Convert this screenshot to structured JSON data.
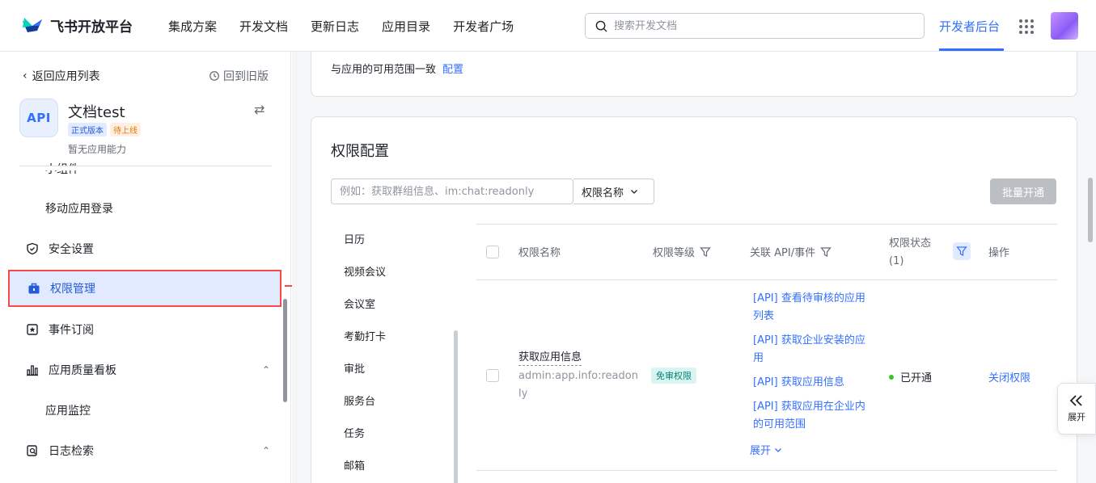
{
  "header": {
    "logo_text": "飞书开放平台",
    "nav": [
      "集成方案",
      "开发文档",
      "更新日志",
      "应用目录",
      "开发者广场"
    ],
    "search_placeholder": "搜索开发文档",
    "dev_console": "开发者后台"
  },
  "sidebar": {
    "back_label": "返回应用列表",
    "old_version_label": "回到旧版",
    "app_icon_text": "API",
    "app_name": "文档test",
    "badge_release": "正式版本",
    "badge_pending": "待上线",
    "app_sub": "暂无应用能力",
    "items": {
      "widget": "小组件",
      "mobile_login": "移动应用登录",
      "security": "安全设置",
      "permissions": "权限管理",
      "events": "事件订阅",
      "quality": "应用质量看板",
      "monitor": "应用监控",
      "logs": "日志检索"
    }
  },
  "main": {
    "scope_text": "与应用的可用范围一致",
    "scope_link": "配置",
    "perm_title": "权限配置",
    "perm_search_placeholder": "例如：获取群组信息、im:chat:readonly",
    "perm_select_label": "权限名称",
    "batch_button": "批量开通",
    "categories": [
      "日历",
      "视频会议",
      "会议室",
      "考勤打卡",
      "审批",
      "服务台",
      "任务",
      "邮箱"
    ],
    "table": {
      "col_name": "权限名称",
      "col_level": "权限等级",
      "col_api": "关联 API/事件",
      "col_status": "权限状态",
      "col_status_count": "(1)",
      "col_action": "操作"
    },
    "row": {
      "name": "获取应用信息",
      "code": "admin:app.info:readonly",
      "level": "免审权限",
      "apis": [
        "[API] 查看待审核的应用列表",
        "[API] 获取企业安装的应用",
        "[API] 获取应用信息",
        "[API] 获取应用在企业内的可用范围"
      ],
      "expand": "展开",
      "status": "已开通",
      "action": "关闭权限"
    },
    "side_expand": "展开"
  }
}
